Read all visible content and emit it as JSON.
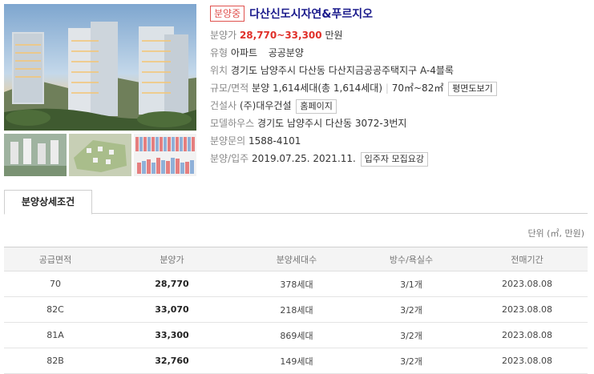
{
  "header": {
    "status_badge": "분양중",
    "title": "다산신도시자연&푸르지오"
  },
  "info": {
    "price_label": "분양가",
    "price_value": "28,770~33,300",
    "price_unit": "만원",
    "type_label": "유형",
    "type_value": "아파트",
    "type_value2": "공공분양",
    "location_label": "위치",
    "location_value": "경기도 남양주시 다산동 다산지금공공주택지구 A-4블록",
    "scale_label": "규모/면적",
    "scale_value": "분양 1,614세대(총 1,614세대)",
    "area_value": "70㎡~82㎡",
    "floorplan_button": "평면도보기",
    "builder_label": "건설사",
    "builder_value": "(주)대우건설",
    "homepage_button": "홈페이지",
    "modelhouse_label": "모델하우스",
    "modelhouse_value": "경기도 남양주시 다산동 3072-3번지",
    "contact_label": "분양문의",
    "contact_value": "1588-4101",
    "dates_label": "분양/입주",
    "sale_date": "2019.07.25.",
    "move_in_date": "2021.11.",
    "notice_button": "입주자 모집요강"
  },
  "tabs": [
    {
      "label": "분양상세조건",
      "active": true
    }
  ],
  "unit_note": "단위 (㎡, 만원)",
  "table": {
    "headers": [
      "공급면적",
      "분양가",
      "분양세대수",
      "방수/욕실수",
      "전매기간"
    ],
    "rows": [
      [
        "70",
        "28,770",
        "378세대",
        "3/1개",
        "2023.08.08"
      ],
      [
        "82C",
        "33,070",
        "218세대",
        "3/2개",
        "2023.08.08"
      ],
      [
        "81A",
        "33,300",
        "869세대",
        "3/2개",
        "2023.08.08"
      ],
      [
        "82B",
        "32,760",
        "149세대",
        "3/2개",
        "2023.08.08"
      ]
    ]
  },
  "colors": {
    "status_red": "#e0524f",
    "title_navy": "#1a1a8c",
    "price_red": "#e0302a"
  }
}
